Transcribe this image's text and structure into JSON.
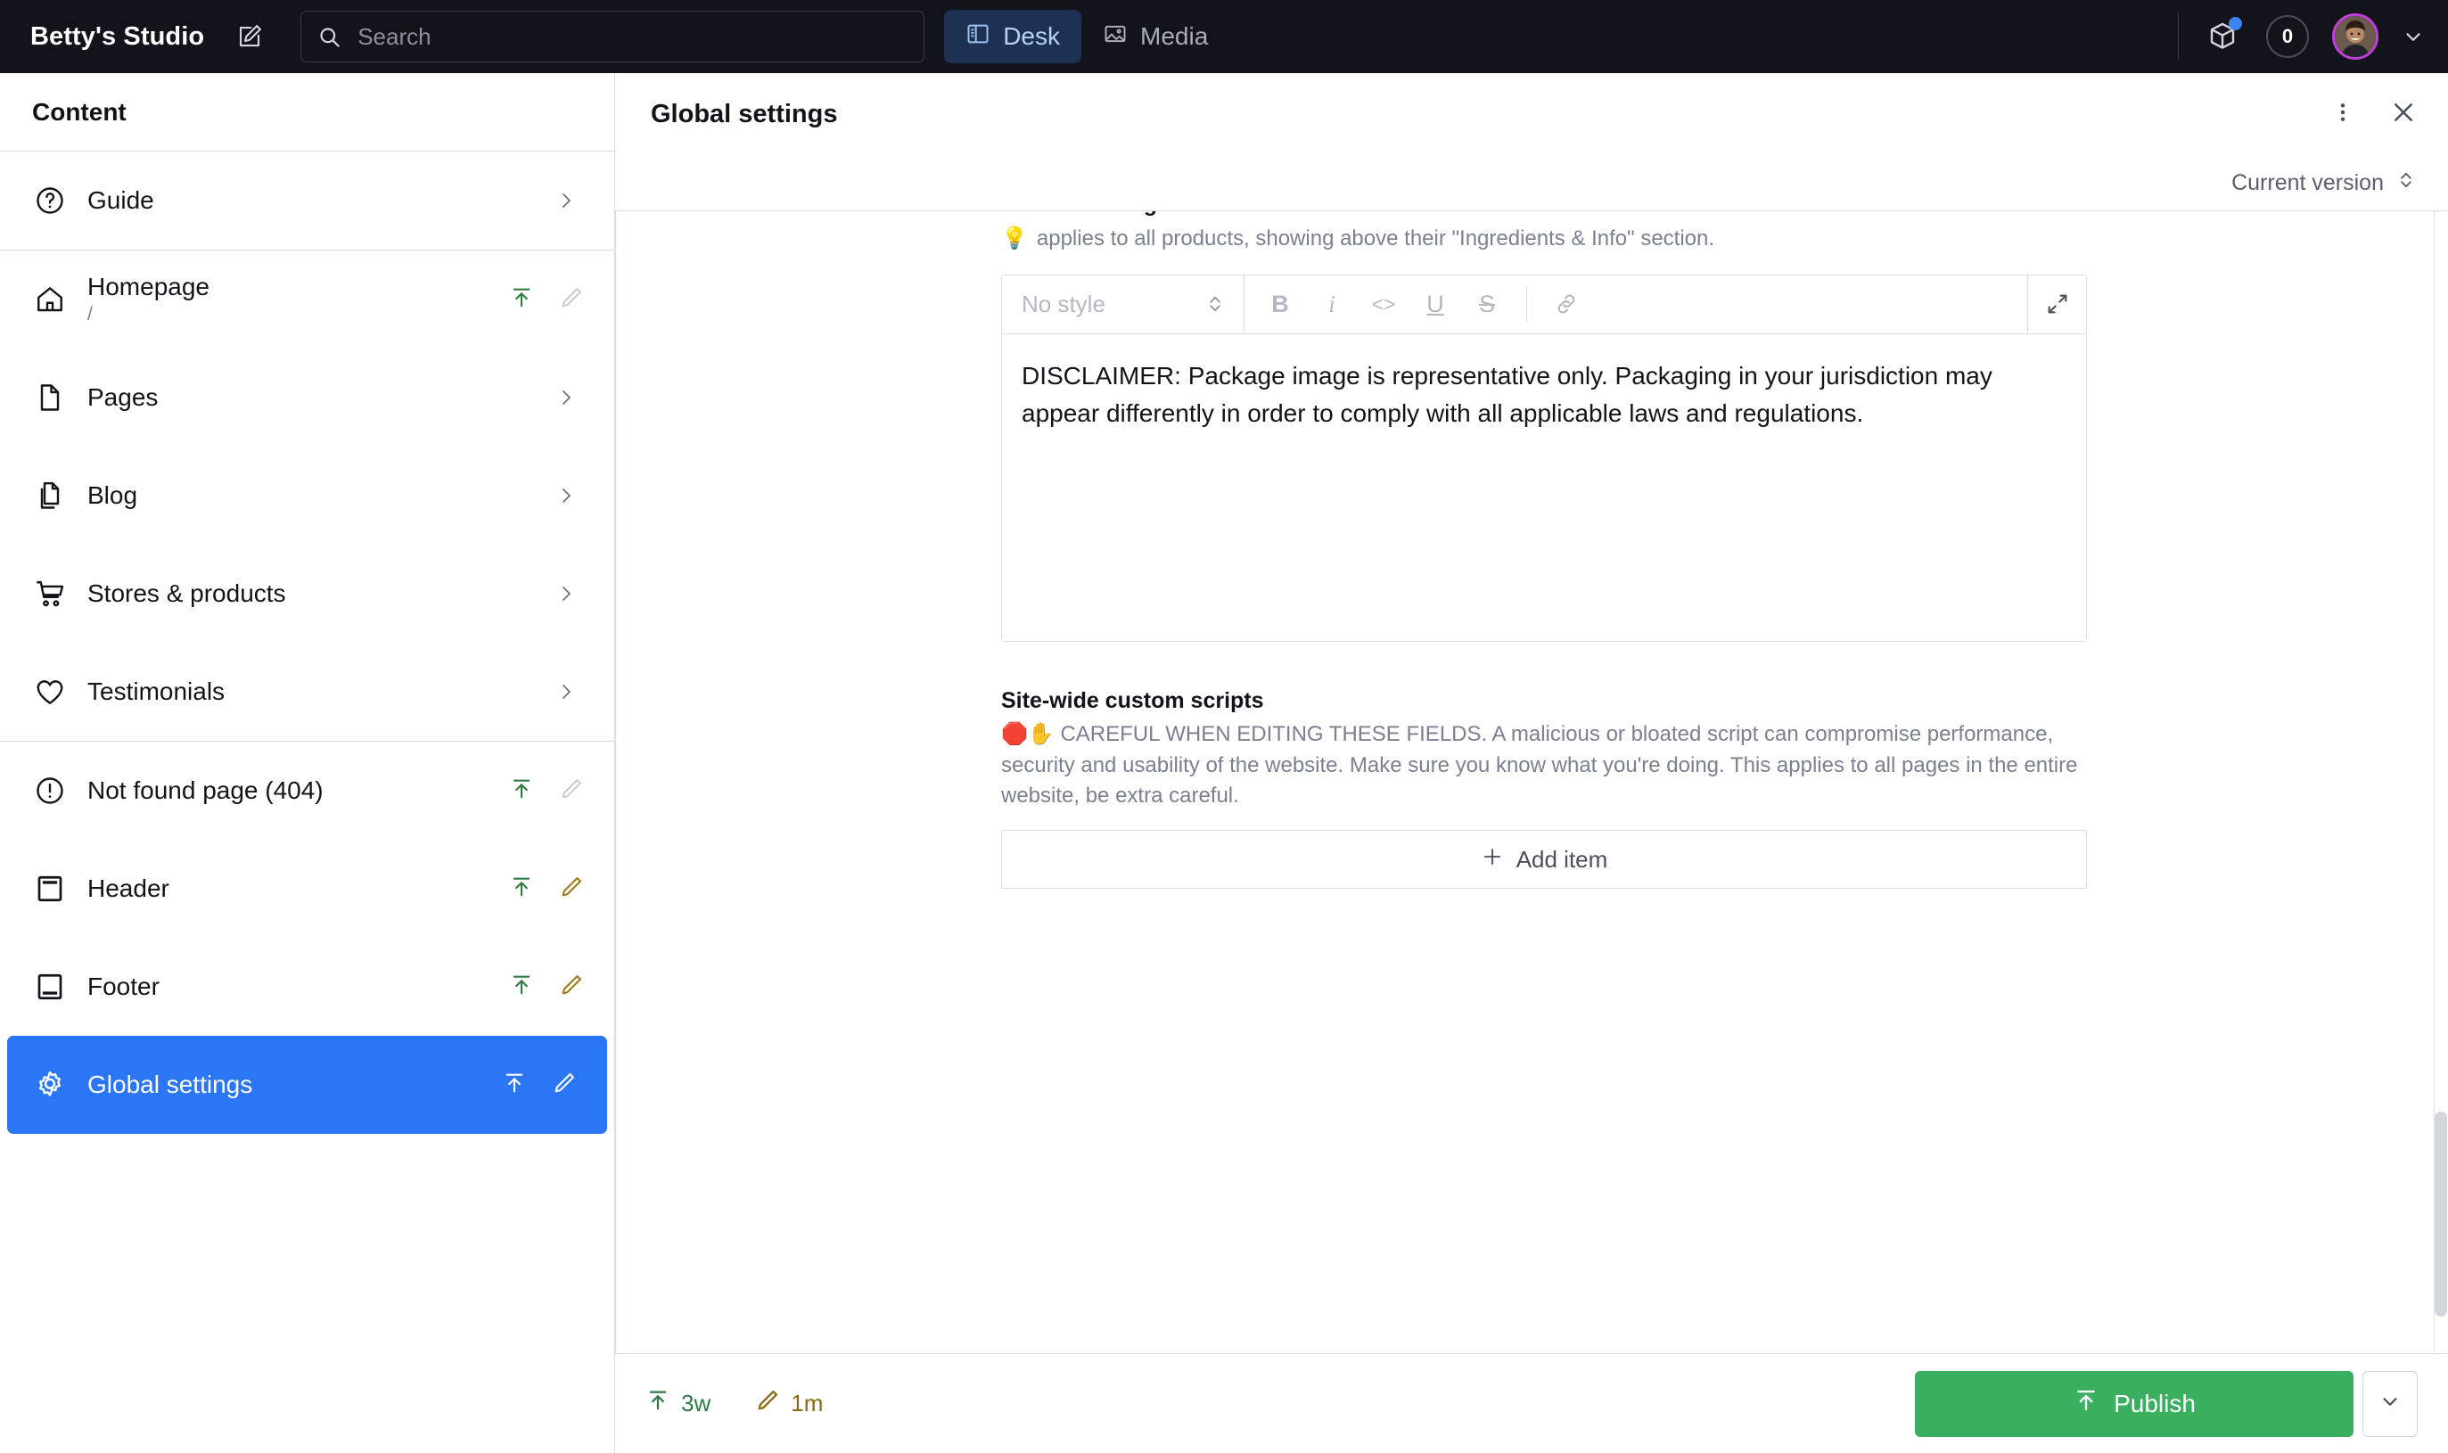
{
  "topbar": {
    "studio_title": "Betty's Studio",
    "compose_icon": "compose-pencil-icon",
    "search": {
      "placeholder": "Search",
      "value": "",
      "icon": "search-icon"
    },
    "nav": [
      {
        "label": "Desk",
        "icon": "desk-panels-icon",
        "active": true
      },
      {
        "label": "Media",
        "icon": "media-image-icon",
        "active": false
      }
    ],
    "package_icon": "package-cube-icon",
    "package_badge": true,
    "count_badge": "0",
    "avatar_icon": "user-avatar",
    "account_chevron_icon": "chevron-down-icon",
    "avatar_ring_color": "#c23ddb",
    "active_nav_bg": "#1e3152"
  },
  "sidebar": {
    "header": "Content",
    "groups": [
      {
        "items": [
          {
            "label": "Guide",
            "icon": "question-circle-icon",
            "trailing": "chevron"
          }
        ]
      },
      {
        "items": [
          {
            "label": "Homepage",
            "sublabel": "/",
            "icon": "home-icon",
            "trailing": "actions",
            "publish_state": "published",
            "edit_state": "none"
          },
          {
            "label": "Pages",
            "icon": "page-icon",
            "trailing": "chevron"
          },
          {
            "label": "Blog",
            "icon": "documents-icon",
            "trailing": "chevron"
          },
          {
            "label": "Stores & products",
            "icon": "cart-icon",
            "trailing": "chevron"
          },
          {
            "label": "Testimonials",
            "icon": "heart-icon",
            "trailing": "chevron"
          }
        ]
      },
      {
        "items": [
          {
            "label": "Not found page (404)",
            "icon": "alert-circle-icon",
            "trailing": "actions",
            "publish_state": "published",
            "edit_state": "none"
          },
          {
            "label": "Header",
            "icon": "header-layout-icon",
            "trailing": "actions",
            "publish_state": "published",
            "edit_state": "edited"
          },
          {
            "label": "Footer",
            "icon": "footer-layout-icon",
            "trailing": "actions",
            "publish_state": "published",
            "edit_state": "edited"
          },
          {
            "label": "Global settings",
            "icon": "gear-icon",
            "trailing": "actions",
            "selected": true,
            "publish_state": "published",
            "edit_state": "edited"
          }
        ]
      }
    ],
    "selected_bg": "#2a76f5"
  },
  "main": {
    "title": "Global settings",
    "more_icon": "kebab-menu-icon",
    "close_icon": "close-icon",
    "version_label": "Current version",
    "version_chevrons_icon": "chevron-up-down-icon",
    "fields": {
      "disclaimer": {
        "label": "Product dosage disclaimer",
        "help_emoji": "💡",
        "help": "applies to all products, showing above their \"Ingredients & Info\" section.",
        "toolbar": {
          "style_value": "No style",
          "style_chevrons_icon": "chevron-up-down-icon",
          "buttons": [
            {
              "label": "B",
              "name": "bold"
            },
            {
              "label": "i",
              "name": "italic"
            },
            {
              "label": "<>",
              "name": "code"
            },
            {
              "label": "U",
              "name": "underline"
            },
            {
              "label": "S",
              "name": "strikethrough"
            }
          ],
          "link_icon": "link-icon",
          "expand_icon": "expand-diagonal-icon"
        },
        "value": "DISCLAIMER: Package image is representative only. Packaging in your jurisdiction may appear differently in order to comply with all applicable laws and regulations."
      },
      "scripts": {
        "label": "Site-wide custom scripts",
        "help_emoji": "🛑✋",
        "help": "CAREFUL WHEN EDITING THESE FIELDS. A malicious or bloated script can compromise performance, security and usability of the website. Make sure you know what you're doing. This applies to all pages in the entire website, be extra careful.",
        "add_item_label": "Add item",
        "add_item_icon": "plus-icon"
      }
    }
  },
  "footer": {
    "published_ago": "3w",
    "published_icon": "publish-arrow-icon",
    "edited_ago": "1m",
    "edited_icon": "pencil-icon",
    "publish_label": "Publish",
    "publish_icon": "publish-arrow-icon",
    "publish_caret_icon": "chevron-down-icon",
    "publish_color": "#3aaf5f",
    "published_text_color": "#2f7a43",
    "edited_text_color": "#8a6a14"
  }
}
